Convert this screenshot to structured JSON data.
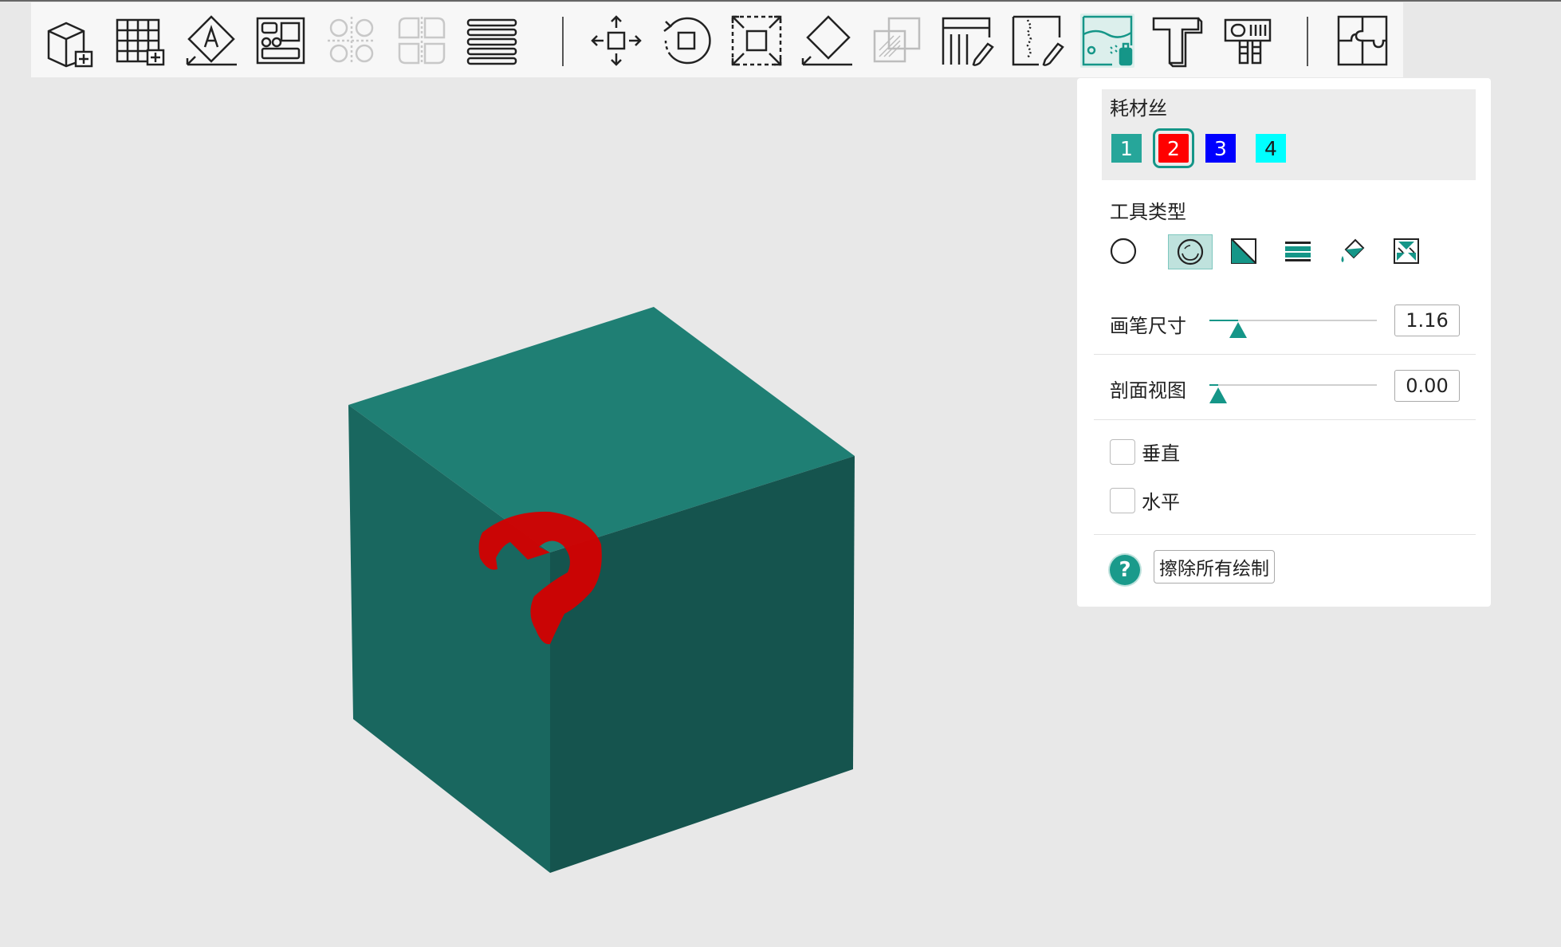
{
  "toolbar": {
    "tools": [
      {
        "icon": "add-cube-icon"
      },
      {
        "icon": "add-plate-icon"
      },
      {
        "icon": "auto-orient-icon"
      },
      {
        "icon": "arrange-icon"
      },
      {
        "icon": "split-objects-icon"
      },
      {
        "icon": "split-parts-icon"
      },
      {
        "icon": "layers-icon"
      },
      {
        "icon": "move-icon"
      },
      {
        "icon": "rotate-icon"
      },
      {
        "icon": "scale-icon"
      },
      {
        "icon": "lay-on-face-icon"
      },
      {
        "icon": "cut-icon"
      },
      {
        "icon": "support-paint-icon"
      },
      {
        "icon": "seam-paint-icon"
      },
      {
        "icon": "color-paint-icon"
      },
      {
        "icon": "text-emboss-icon"
      },
      {
        "icon": "measure-icon"
      },
      {
        "icon": "assembly-icon"
      }
    ],
    "active_tool": "color-paint-icon"
  },
  "panel": {
    "filament_title": "耗材丝",
    "filaments": [
      {
        "label": "1",
        "color": "#26a69a"
      },
      {
        "label": "2",
        "color": "#ff0000"
      },
      {
        "label": "3",
        "color": "#0000ff"
      },
      {
        "label": "4",
        "color": "#00ffff"
      }
    ],
    "selected_filament": "2",
    "tool_type_title": "工具类型",
    "tool_types": [
      {
        "icon": "circle-brush-icon"
      },
      {
        "icon": "sphere-brush-icon"
      },
      {
        "icon": "triangle-fill-icon"
      },
      {
        "icon": "height-range-icon"
      },
      {
        "icon": "bucket-fill-icon"
      },
      {
        "icon": "gap-fill-icon"
      }
    ],
    "active_tool_type": "sphere-brush-icon",
    "brush_size_label": "画笔尺寸",
    "brush_size_value": "1.16",
    "brush_size_fraction": 0.17,
    "section_view_label": "剖面视图",
    "section_view_value": "0.00",
    "section_view_fraction": 0.05,
    "vertical_label": "垂直",
    "vertical_checked": false,
    "horizontal_label": "水平",
    "horizontal_checked": false,
    "help_symbol": "?",
    "erase_all_label": "擦除所有绘制"
  },
  "scene": {
    "object": "cube",
    "cube_colors": {
      "top": "#1f7f74",
      "left": "#19675f",
      "right": "#15544e"
    },
    "paint_color": "#d40000"
  }
}
